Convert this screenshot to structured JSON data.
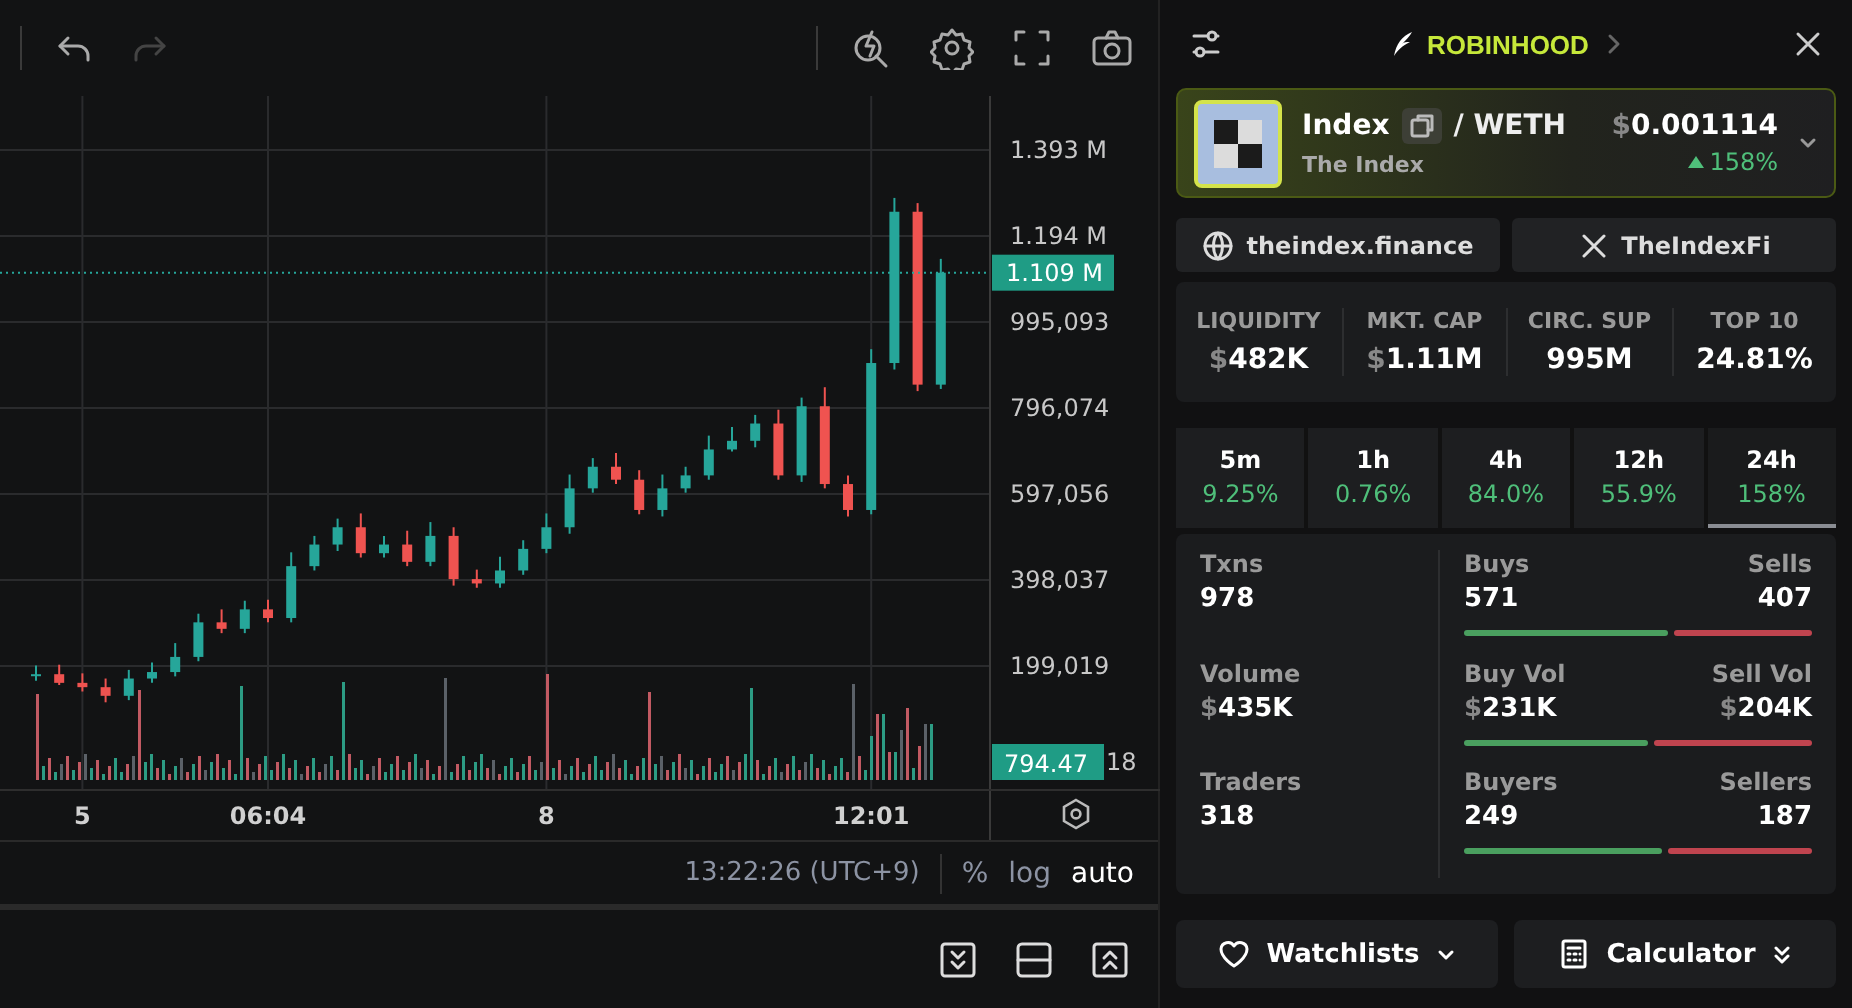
{
  "toolbar": {
    "buttons": [
      {
        "kind": "undo",
        "disabled": false
      },
      {
        "kind": "redo",
        "disabled": true
      }
    ],
    "tools": [
      {
        "kind": "indicator"
      },
      {
        "kind": "settings"
      },
      {
        "kind": "fullscreen"
      },
      {
        "kind": "snapshot"
      }
    ]
  },
  "chart": {
    "chart_data": {
      "type": "candlestick",
      "categories": [
        null,
        null,
        "5",
        null,
        null,
        null,
        null,
        null,
        null,
        null,
        "06:04",
        null,
        null,
        null,
        null,
        null,
        null,
        null,
        null,
        null,
        null,
        null,
        "8",
        null,
        null,
        null,
        null,
        null,
        null,
        null,
        null,
        null,
        null,
        null,
        null,
        null,
        "12:01",
        null,
        null,
        null
      ],
      "ohlc": [
        [
          180000,
          200000,
          165000,
          180000
        ],
        [
          180000,
          202000,
          155000,
          160000
        ],
        [
          160000,
          182000,
          140000,
          150000
        ],
        [
          150000,
          170000,
          115000,
          130000
        ],
        [
          130000,
          190000,
          120000,
          170000
        ],
        [
          170000,
          207000,
          160000,
          185000
        ],
        [
          185000,
          252000,
          175000,
          220000
        ],
        [
          220000,
          320000,
          210000,
          300000
        ],
        [
          300000,
          330000,
          275000,
          285000
        ],
        [
          285000,
          350000,
          275000,
          330000
        ],
        [
          330000,
          352000,
          300000,
          310000
        ],
        [
          310000,
          462000,
          300000,
          430000
        ],
        [
          430000,
          500000,
          420000,
          480000
        ],
        [
          480000,
          540000,
          465000,
          520000
        ],
        [
          520000,
          552000,
          450000,
          460000
        ],
        [
          460000,
          500000,
          450000,
          480000
        ],
        [
          480000,
          512000,
          430000,
          440000
        ],
        [
          440000,
          532000,
          430000,
          500000
        ],
        [
          500000,
          520000,
          385000,
          400000
        ],
        [
          400000,
          422000,
          380000,
          390000
        ],
        [
          390000,
          452000,
          380000,
          420000
        ],
        [
          420000,
          490000,
          410000,
          470000
        ],
        [
          470000,
          552000,
          460000,
          520000
        ],
        [
          520000,
          642000,
          505000,
          610000
        ],
        [
          610000,
          680000,
          600000,
          660000
        ],
        [
          660000,
          692000,
          620000,
          630000
        ],
        [
          630000,
          652000,
          550000,
          560000
        ],
        [
          560000,
          642000,
          545000,
          610000
        ],
        [
          610000,
          660000,
          600000,
          640000
        ],
        [
          640000,
          732000,
          630000,
          700000
        ],
        [
          700000,
          752000,
          695000,
          720000
        ],
        [
          720000,
          780000,
          705000,
          760000
        ],
        [
          760000,
          792000,
          630000,
          640000
        ],
        [
          640000,
          820000,
          625000,
          800000
        ],
        [
          800000,
          844000,
          610000,
          620000
        ],
        [
          620000,
          640000,
          545000,
          560000
        ],
        [
          560000,
          932000,
          550000,
          900000
        ],
        [
          900000,
          1282000,
          885000,
          1250000
        ],
        [
          1250000,
          1270000,
          835000,
          850000
        ],
        [
          850000,
          1141000,
          840000,
          1109000
        ]
      ],
      "ylim": [
        -87900,
        1517800
      ],
      "grid": true,
      "ref_lines": [
        {
          "axis": "y",
          "value": 1109000,
          "label": "1.109 M"
        }
      ],
      "yticks": [
        {
          "value": 1393000,
          "label": "1.393 M"
        },
        {
          "value": 1194000,
          "label": "1.194 M"
        },
        {
          "value": 995093,
          "label": "995,093"
        },
        {
          "value": 796074,
          "label": "796,074"
        },
        {
          "value": 597056,
          "label": "597,056"
        },
        {
          "value": 398037,
          "label": "398,037"
        },
        {
          "value": 199019,
          "label": "199,019"
        }
      ]
    },
    "volume_badge": "794.47",
    "volume_tick_fragment": "18"
  },
  "status_row": {
    "time": "13:22:26 (UTC+9)",
    "scales": [
      {
        "label": "%",
        "selected": false
      },
      {
        "label": "log",
        "selected": false
      },
      {
        "label": "auto",
        "selected": true
      }
    ]
  },
  "pane_buttons": [
    {
      "kind": "collapse"
    },
    {
      "kind": "split"
    },
    {
      "kind": "expand"
    }
  ],
  "header": {
    "chain": "ROBINHOOD"
  },
  "token": {
    "symbol": "Index",
    "quote": "/ WETH",
    "name": "The Index",
    "currency": "$",
    "price": "0.001114",
    "change": "158%"
  },
  "links": [
    {
      "kind": "web",
      "label": "theindex.finance"
    },
    {
      "kind": "x",
      "label": "TheIndexFi"
    }
  ],
  "stats": [
    {
      "label": "LIQUIDITY",
      "currency": "$",
      "value": "482K"
    },
    {
      "label": "MKT. CAP",
      "currency": "$",
      "value": "1.11M"
    },
    {
      "label": "CIRC. SUP",
      "value": "995M"
    },
    {
      "label": "TOP 10",
      "value": "24.81%"
    }
  ],
  "periods": [
    {
      "label": "5m",
      "change": "9.25%",
      "selected": false
    },
    {
      "label": "1h",
      "change": "0.76%",
      "selected": false
    },
    {
      "label": "4h",
      "change": "84.0%",
      "selected": false
    },
    {
      "label": "12h",
      "change": "55.9%",
      "selected": false
    },
    {
      "label": "24h",
      "change": "158%",
      "selected": true
    }
  ],
  "activity": [
    {
      "total": {
        "label": "Txns",
        "value": "978"
      },
      "buy": {
        "label": "Buys",
        "value": "571"
      },
      "sell": {
        "label": "Sells",
        "value": "407"
      },
      "level": 0.584
    },
    {
      "total": {
        "label": "Volume",
        "currency": "$",
        "value": "435K"
      },
      "buy": {
        "label": "Buy Vol",
        "currency": "$",
        "value": "231K"
      },
      "sell": {
        "label": "Sell Vol",
        "currency": "$",
        "value": "204K"
      },
      "level": 0.531
    },
    {
      "total": {
        "label": "Traders",
        "value": "318"
      },
      "buy": {
        "label": "Buyers",
        "value": "249"
      },
      "sell": {
        "label": "Sellers",
        "value": "187"
      },
      "level": 0.571
    }
  ],
  "footer_buttons": [
    {
      "kind": "watchlist",
      "label": "Watchlists"
    },
    {
      "kind": "calculator",
      "label": "Calculator"
    }
  ]
}
